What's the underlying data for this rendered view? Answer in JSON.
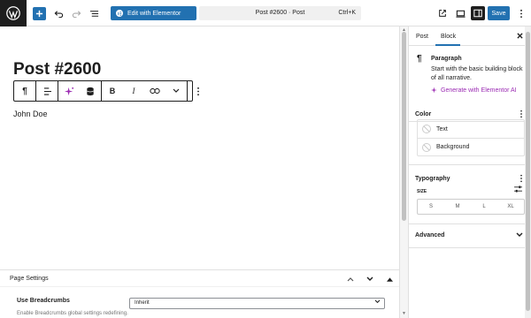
{
  "toolbar": {
    "edit_with_elementor": "Edit with Elementor",
    "command_title": "Post #2600 · Post",
    "command_shortcut": "Ctrl+K",
    "save_label": "Save"
  },
  "editor": {
    "post_title": "Post #2600",
    "paragraph": "John Doe"
  },
  "metabox": {
    "title": "Page Settings",
    "breadcrumbs_label": "Use Breadcrumbs",
    "breadcrumbs_desc": "Enable Breadcrumbs global settings redefining.",
    "breadcrumbs_value": "Inherit"
  },
  "sidebar": {
    "tabs": [
      {
        "label": "Post"
      },
      {
        "label": "Block"
      }
    ],
    "block": {
      "title": "Paragraph",
      "description": "Start with the basic building block of all narrative.",
      "ai_link": "Generate with Elementor AI"
    },
    "color": {
      "title": "Color",
      "items": [
        {
          "label": "Text"
        },
        {
          "label": "Background"
        }
      ]
    },
    "typography": {
      "title": "Typography",
      "size_label": "SIZE",
      "sizes": [
        "S",
        "M",
        "L",
        "XL"
      ]
    },
    "advanced": {
      "title": "Advanced"
    }
  },
  "colors": {
    "accent": "#2271b1",
    "dark": "#1e1e1e",
    "ai": "#9b2bb3"
  }
}
